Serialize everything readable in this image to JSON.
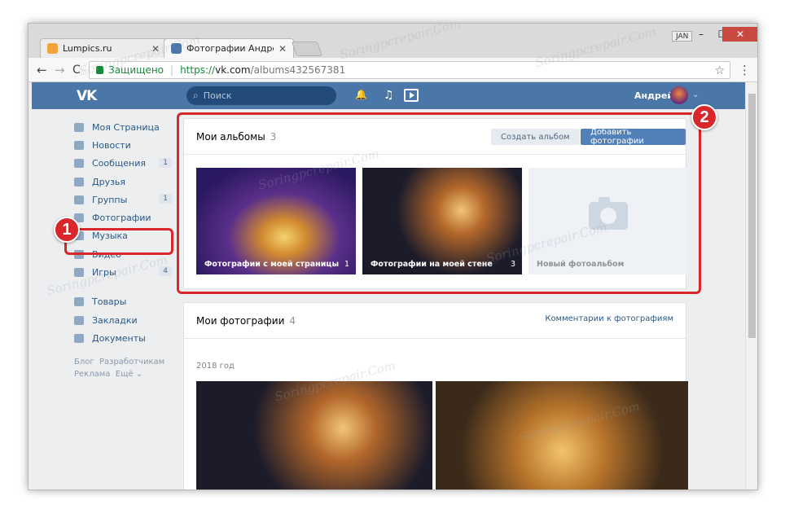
{
  "browser": {
    "tabs": [
      {
        "title": "Lumpics.ru",
        "favicon_color": "#f2a33a"
      },
      {
        "title": "Фотографии Андрея Пе",
        "favicon_color": "#4a76a8"
      }
    ],
    "user_badge": "JAN",
    "window_buttons": [
      "–",
      "☐",
      "✕"
    ],
    "nav": {
      "back": "←",
      "forward": "→",
      "reload": "C"
    },
    "address": {
      "secure_label": "Защищено",
      "separator": "|",
      "scheme": "https://",
      "host": "vk.com",
      "path": "/albums432567381"
    },
    "star_icon": "☆",
    "menu_icon": "⋮"
  },
  "vk": {
    "logo": "VK",
    "search_placeholder": "Поиск",
    "search_icon": "⌕",
    "bell_icon": "🔔",
    "music_icon": "♫",
    "user_name": "Андрей",
    "caret": "⌄"
  },
  "sidebar": {
    "items": [
      {
        "label": "Моя Страница"
      },
      {
        "label": "Новости"
      },
      {
        "label": "Сообщения",
        "count": "1"
      },
      {
        "label": "Друзья"
      },
      {
        "label": "Группы",
        "count": "1"
      },
      {
        "label": "Фотографии"
      },
      {
        "label": "Музыка"
      },
      {
        "label": "Видео"
      },
      {
        "label": "Игры",
        "count": "4"
      }
    ],
    "items2": [
      {
        "label": "Товары"
      },
      {
        "label": "Закладки"
      },
      {
        "label": "Документы"
      }
    ],
    "footer": {
      "blog": "Блог",
      "dev": "Разработчикам",
      "ads": "Реклама",
      "more": "Ещё ⌄"
    }
  },
  "albums": {
    "title": "Мои альбомы",
    "count": "3",
    "create_button": "Создать альбом",
    "add_button": "Добавить фотографии",
    "items": [
      {
        "label": "Фотографии с моей страницы",
        "count": "1"
      },
      {
        "label": "Фотографии на моей стене",
        "count": "3"
      },
      {
        "label": "Новый фотоальбом",
        "count": ""
      }
    ]
  },
  "photos": {
    "title": "Мои фотографии",
    "count": "4",
    "comments_link": "Комментарии к фотографиям",
    "year": "2018 год"
  },
  "annotations": {
    "badge1": "1",
    "badge2": "2",
    "color": "#d8262b"
  },
  "watermark": "Soringpcrepair.Com"
}
